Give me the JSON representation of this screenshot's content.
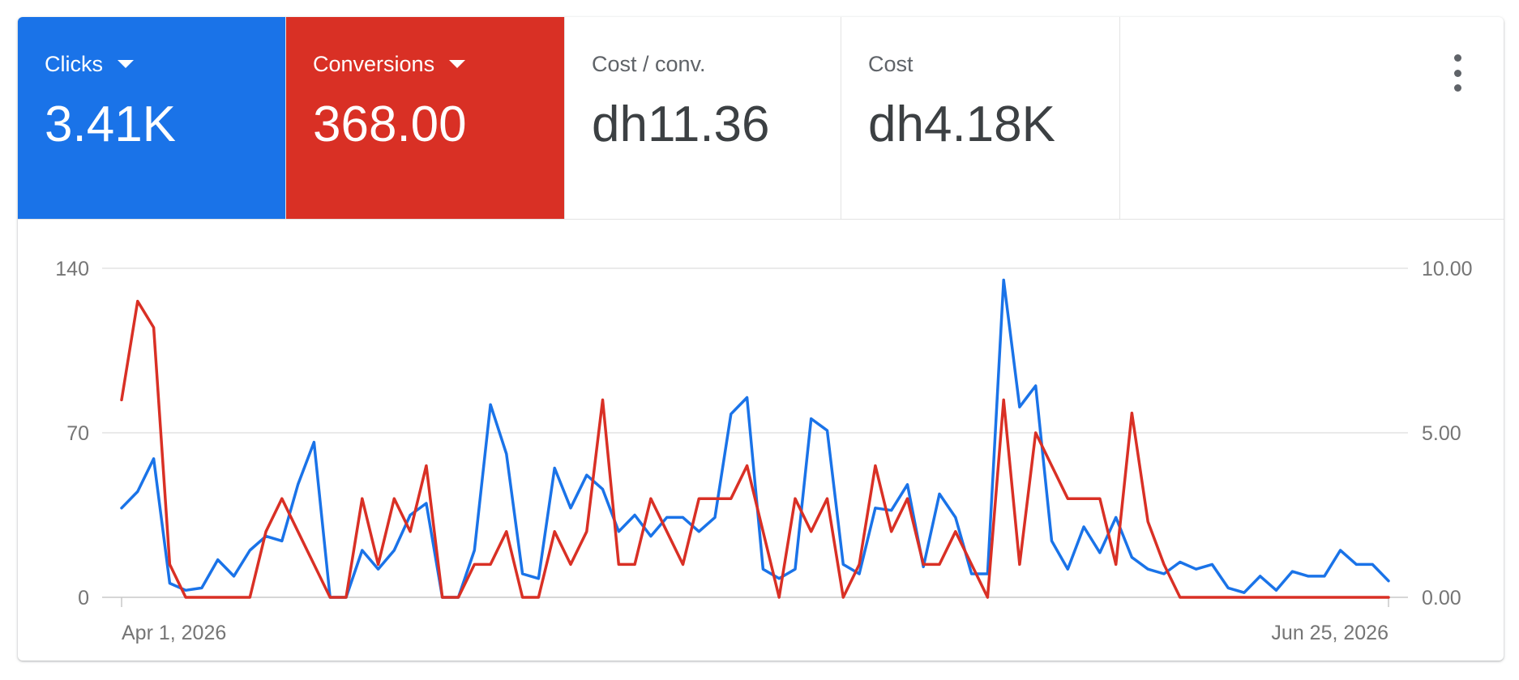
{
  "scorecards": [
    {
      "label": "Clicks",
      "value": "3.41K",
      "selected": true,
      "color": "#1a73e8",
      "has_dropdown": true
    },
    {
      "label": "Conversions",
      "value": "368.00",
      "selected": true,
      "color": "#d93025",
      "has_dropdown": true
    },
    {
      "label": "Cost / conv.",
      "value": "dh11.36",
      "selected": false,
      "has_dropdown": false
    },
    {
      "label": "Cost",
      "value": "dh4.18K",
      "selected": false,
      "has_dropdown": false
    }
  ],
  "more_menu_icon": "more-vert-icon",
  "chart_data": {
    "type": "line",
    "title": "",
    "x": {
      "start": "Apr 1, 2026",
      "end": "Jun 25, 2026",
      "tick_labels": [
        "Apr 1, 2026",
        "Jun 25, 2026"
      ]
    },
    "y_left": {
      "ylim": [
        0,
        140
      ],
      "ticks": [
        "0",
        "70",
        "140"
      ]
    },
    "y_right": {
      "ylim": [
        0,
        10
      ],
      "ticks": [
        "0.00",
        "5.00",
        "10.00"
      ]
    },
    "grid": true,
    "series": [
      {
        "name": "Clicks",
        "axis": "left",
        "color": "#1a73e8",
        "values": [
          38,
          45,
          59,
          6,
          3,
          4,
          16,
          9,
          20,
          26,
          24,
          48,
          66,
          0,
          0,
          20,
          12,
          20,
          35,
          40,
          0,
          0,
          20,
          82,
          61,
          10,
          8,
          55,
          38,
          52,
          46,
          28,
          35,
          26,
          34,
          34,
          28,
          34,
          78,
          85,
          12,
          8,
          12,
          76,
          71,
          14,
          10,
          38,
          37,
          48,
          13,
          44,
          34,
          10,
          10,
          135,
          81,
          90,
          24,
          12,
          30,
          19,
          34,
          17,
          12,
          10,
          15,
          12,
          14,
          4,
          2,
          9,
          3,
          11,
          9,
          9,
          20,
          14,
          14,
          7
        ]
      },
      {
        "name": "Conversions",
        "axis": "right",
        "color": "#d93025",
        "values": [
          6,
          9,
          8.2,
          1,
          0,
          0,
          0,
          0,
          0,
          2,
          3,
          2,
          1,
          0,
          0,
          3,
          1,
          3,
          2,
          4,
          0,
          0,
          1,
          1,
          2,
          0,
          0,
          2,
          1,
          2,
          6,
          1,
          1,
          3,
          2,
          1,
          3,
          3,
          3,
          4,
          2,
          0,
          3,
          2,
          3,
          0,
          1,
          4,
          2,
          3,
          1,
          1,
          2,
          1,
          0,
          6,
          1,
          5,
          4,
          3,
          3,
          3,
          1,
          5.6,
          2.3,
          1,
          0,
          0,
          0,
          0,
          0,
          0,
          0,
          0,
          0,
          0,
          0,
          0,
          0,
          0
        ]
      }
    ]
  }
}
